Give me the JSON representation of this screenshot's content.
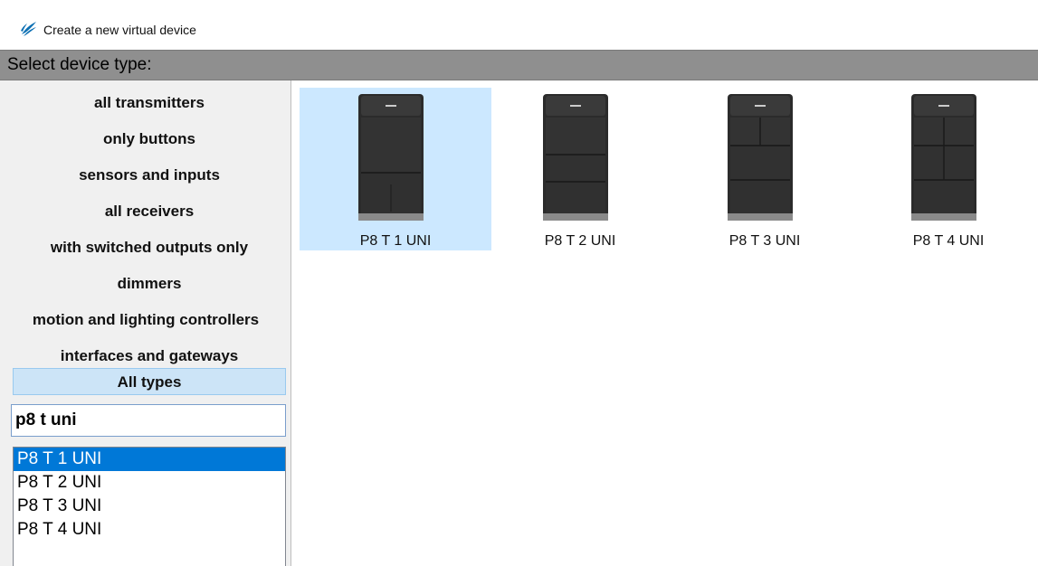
{
  "window": {
    "title": "Create a new virtual device",
    "icon": "app-wing-icon",
    "accent_color": "#0b6fb3"
  },
  "header": {
    "label": "Select device type:"
  },
  "categories": [
    {
      "label": "all transmitters"
    },
    {
      "label": "only buttons"
    },
    {
      "label": "sensors and inputs"
    },
    {
      "label": "all receivers"
    },
    {
      "label": "with switched outputs only"
    },
    {
      "label": "dimmers"
    },
    {
      "label": "motion and lighting controllers"
    },
    {
      "label": "interfaces and gateways"
    },
    {
      "label": "All types",
      "selected": true
    }
  ],
  "search": {
    "value": "p8 t uni"
  },
  "results": [
    {
      "label": "P8 T 1 UNI",
      "selected": true
    },
    {
      "label": "P8 T 2 UNI"
    },
    {
      "label": "P8 T 3 UNI"
    },
    {
      "label": "P8 T 4 UNI"
    }
  ],
  "devices": [
    {
      "label": "P8 T 1 UNI",
      "selected": true,
      "icon": "transmitter-1-icon"
    },
    {
      "label": "P8 T 2 UNI",
      "icon": "transmitter-2-icon"
    },
    {
      "label": "P8 T 3 UNI",
      "icon": "transmitter-3-icon"
    },
    {
      "label": "P8 T 4 UNI",
      "icon": "transmitter-4-icon"
    }
  ],
  "colors": {
    "selection": "#0078d7",
    "tile_selection": "#cce8ff",
    "header_bg": "#8f8f8f"
  }
}
